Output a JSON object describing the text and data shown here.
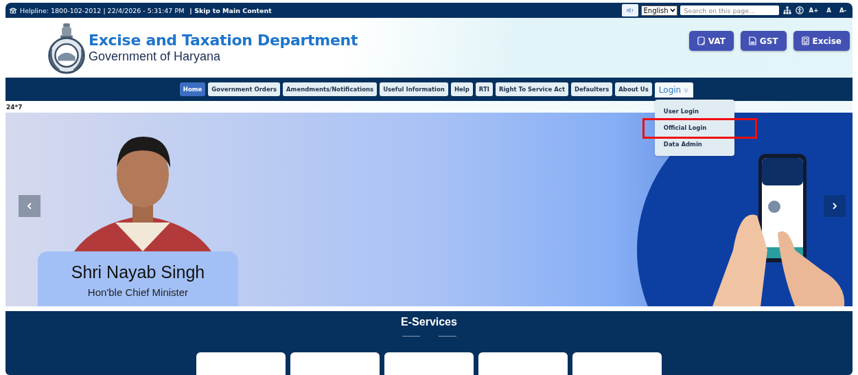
{
  "top_bar": {
    "helpline": "Helpline: 1800-102-2012 | 22/4/2026 - 5:31:47 PM",
    "skip_link": "| Skip to Main Content",
    "language": "English",
    "search": {
      "placeholder": "Search on this page..."
    },
    "font_sizes": [
      "A+",
      "A",
      "A-"
    ]
  },
  "header": {
    "title": "Excise and Taxation Department",
    "subtitle": "Government of Haryana",
    "buttons": [
      {
        "label": "VAT",
        "kind": "vat"
      },
      {
        "label": "GST",
        "kind": "gst"
      },
      {
        "label": "Excise",
        "kind": "excise"
      }
    ]
  },
  "nav": [
    {
      "label": "Home",
      "selected": true,
      "kind": "link"
    },
    {
      "label": "Government Orders",
      "selected": false,
      "kind": "link"
    },
    {
      "label": "Amendments/Notifications",
      "selected": false,
      "kind": "link"
    },
    {
      "label": "Useful Information",
      "selected": false,
      "kind": "link"
    },
    {
      "label": "Help",
      "selected": false,
      "kind": "link"
    },
    {
      "label": "RTI",
      "selected": false,
      "kind": "link"
    },
    {
      "label": "Right To Service Act",
      "selected": false,
      "kind": "link"
    },
    {
      "label": "Defaulters",
      "selected": false,
      "kind": "link"
    },
    {
      "label": "About Us",
      "selected": false,
      "kind": "link"
    },
    {
      "label": "Login",
      "selected": false,
      "kind": "dropdown",
      "expanded": true,
      "children": [
        {
          "label": "User Login",
          "highlighted": false
        },
        {
          "label": "Official Login",
          "highlighted": true
        },
        {
          "label": "Data Admin",
          "highlighted": false
        }
      ]
    }
  ],
  "ticker_label": "24*7",
  "banner": {
    "kind": "picture",
    "caption_name": "Shri Nayab Singh",
    "caption_role": "Hon'ble Chief Minister"
  },
  "e_services": {
    "title": "E-Services"
  }
}
